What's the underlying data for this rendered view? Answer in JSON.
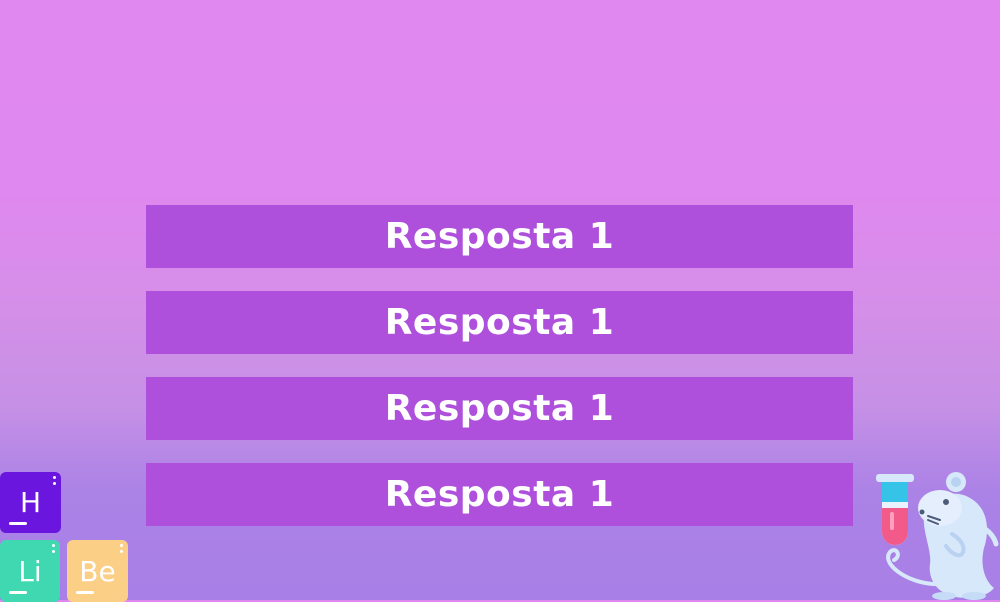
{
  "answers": [
    {
      "label": "Resposta 1"
    },
    {
      "label": "Resposta 1"
    },
    {
      "label": "Resposta 1"
    },
    {
      "label": "Resposta 1"
    }
  ],
  "elements": {
    "h": "H",
    "li": "Li",
    "be": "Be"
  },
  "colors": {
    "answer_bg": "#ae50dc",
    "answer_text": "#ffffff",
    "tile_h": "#6a16de",
    "tile_li": "#3fd8b0",
    "tile_be": "#fbcf85",
    "mouse": "#d8e8fb",
    "tube_liquid": "#f25a8a",
    "tube_top": "#36c3e8"
  },
  "icons": {
    "decoration": "periodic-element-tiles",
    "mascot": "lab-mouse-with-test-tube"
  }
}
